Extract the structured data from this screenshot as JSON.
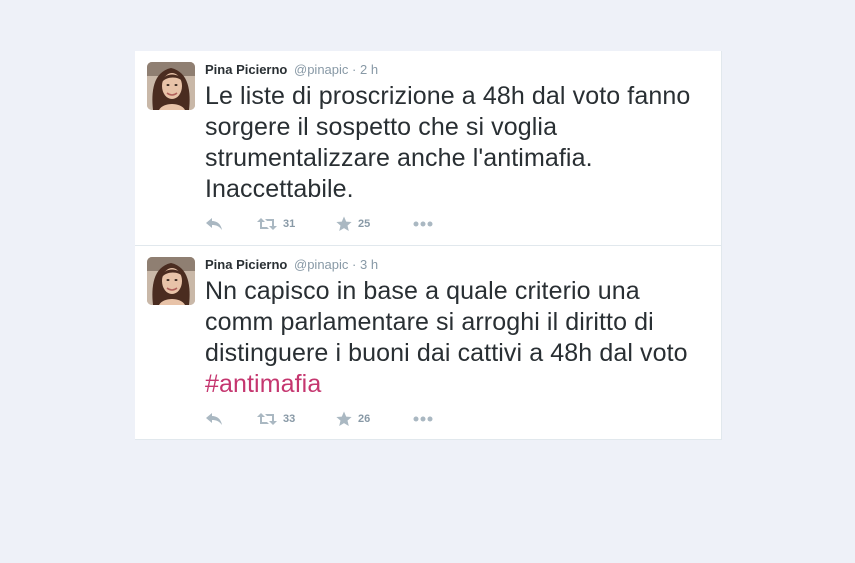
{
  "tweets": [
    {
      "fullname": "Pina Picierno",
      "username": "@pinapic",
      "separator": "·",
      "time": "2 h",
      "text": "Le liste di proscrizione a 48h dal voto fanno sorgere il sospetto che si voglia strumentalizzare anche l'antimafia. Inaccettabile.",
      "hashtag": "",
      "retweets": "31",
      "favorites": "25"
    },
    {
      "fullname": "Pina Picierno",
      "username": "@pinapic",
      "separator": "·",
      "time": "3 h",
      "text": "Nn capisco in base a quale criterio una comm parlamentare si arroghi il diritto di distinguere i buoni dai cattivi a 48h dal voto ",
      "hashtag": "#antimafia",
      "retweets": "33",
      "favorites": "26"
    }
  ],
  "icons": {
    "reply": "reply-icon",
    "retweet": "retweet-icon",
    "favorite": "star-icon",
    "more": "more-icon"
  },
  "colors": {
    "background": "#eef1f8",
    "card": "#ffffff",
    "text": "#292f33",
    "meta": "#8899a6",
    "icon": "#aab8c2",
    "hashtag": "#c5366f"
  }
}
